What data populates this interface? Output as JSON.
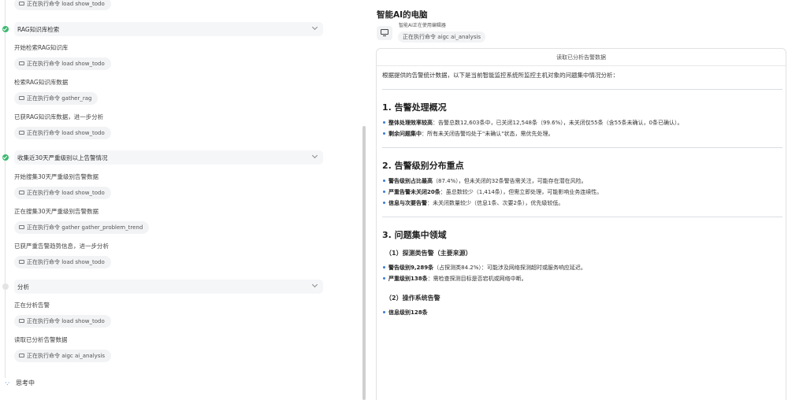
{
  "left": {
    "top_chip": "正在执行命令 load show_todo",
    "groups": [
      {
        "title": "RAG知识库检索",
        "status": "done",
        "steps": [
          {
            "text": "开始检索RAG知识库",
            "chip": "正在执行命令 load show_todo"
          },
          {
            "text": "检索RAG知识库数据",
            "chip": "正在执行命令 gather_rag"
          },
          {
            "text": "已获RAG知识库数据，进一步分析",
            "chip": "正在执行命令 load show_todo"
          }
        ]
      },
      {
        "title": "收集近30天严重级别以上告警情况",
        "status": "done",
        "steps": [
          {
            "text": "开始搜集30天严重级别告警数据",
            "chip": "正在执行命令 load show_todo"
          },
          {
            "text": "正在搜集30天严重级别告警数据",
            "chip": "正在执行命令 gather gather_problem_trend"
          },
          {
            "text": "已获严重告警趋势信息，进一步分析",
            "chip": "正在执行命令 load show_todo"
          }
        ]
      },
      {
        "title": "分析",
        "status": "pending",
        "steps": [
          {
            "text": "正在分析告警",
            "chip": "正在执行命令 load show_todo"
          },
          {
            "text": "读取已分析告警数据",
            "chip": "正在执行命令 aigc ai_analysis"
          }
        ]
      }
    ],
    "thinking": "思考中"
  },
  "right": {
    "title": "智能AI的电脑",
    "status": "智能AI正在使用编辑器",
    "chip": "正在执行命令 aigc ai_analysis",
    "panel_header": "读取已分析告警数据",
    "intro": "根据提供的告警统计数据，以下是当前智能监控系统所监控主机对象的问题集中情况分析：",
    "sections": {
      "s1": {
        "heading": "1. 告警处理概况",
        "b1_bold": "整体处理效率较高",
        "b1_text": "：告警总数12,603条中，已关闭12,548条（99.6%），未关闭仅55条（含55条未确认，0条已确认）。",
        "b2_bold": "剩余问题集中",
        "b2_text": "：所有未关闭告警均处于\"未确认\"状态，需优先处理。"
      },
      "s2": {
        "heading": "2. 告警级别分布重点",
        "b1_bold": "警告级别占比最高",
        "b1_text": "（87.4%），但未关闭的32条警告需关注，可能存在潜在风险。",
        "b2_bold": "严重告警未关闭20条",
        "b2_text": "：虽总数较少（1,414条），但需立即处理，可能影响业务连续性。",
        "b3_bold": "信息与次要告警",
        "b3_text": "：未关闭数量较少（信息1条、次要2条），优先级较低。"
      },
      "s3": {
        "heading": "3. 问题集中领域",
        "sub1": "（1）探测类告警（主要来源）",
        "sub1_b1_bold": "警告级别9,289条",
        "sub1_b1_text": "（占探测类84.2%）：可能涉及网络探测超时或服务响应延迟。",
        "sub1_b2_bold": "严重级别138条",
        "sub1_b2_text": "：需检查探测目标是否宕机或网络中断。",
        "sub2": "（2）操作系统告警",
        "sub2_b1_bold": "信息级别128条",
        "sub2_b1_text": ""
      }
    }
  }
}
